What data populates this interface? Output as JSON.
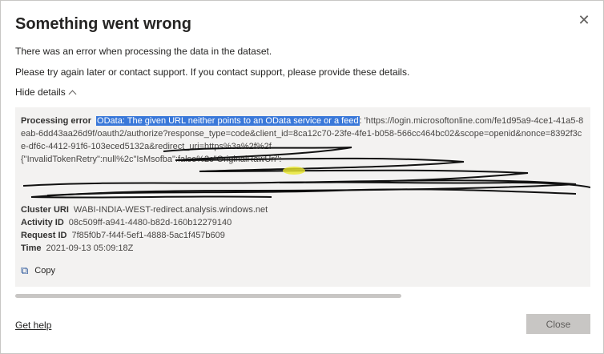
{
  "dialog": {
    "title": "Something went wrong",
    "message1": "There was an error when processing the data in the dataset.",
    "message2": "Please try again later or contact support. If you contact support, please provide these details.",
    "toggle_label": "Hide details"
  },
  "details": {
    "processing_error_label": "Processing error",
    "processing_error_highlight": "OData: The given URL neither points to an OData service or a feed",
    "processing_error_rest": ": 'https://login.microsoftonline.com/fe1d95a9-4ce1-41a5-8eab-6dd43aa26d9f/oauth2/authorize?response_type=code&client_id=8ca12c70-23fe-4fe1-b058-566cc464bc02&scope=openid&nonce=8392f3ce-df6c-4412-91f6-103eced5132a&redirect_uri=https%3a%2f%2f",
    "processing_error_line4": "{\"InvalidTokenRetry\":null%2c\"IsMsofba\":false%2c\"OriginalRawUri\":",
    "cluster_uri_label": "Cluster URI",
    "cluster_uri_value": "WABI-INDIA-WEST-redirect.analysis.windows.net",
    "activity_id_label": "Activity ID",
    "activity_id_value": "08c509ff-a941-4480-b82d-160b12279140",
    "request_id_label": "Request ID",
    "request_id_value": "7f85f0b7-f44f-5ef1-4888-5ac1f457b609",
    "time_label": "Time",
    "time_value": "2021-09-13 05:09:18Z",
    "copy_label": "Copy"
  },
  "footer": {
    "help_label": "Get help",
    "close_label": "Close"
  },
  "colors": {
    "highlight": "#3a78d9",
    "panel": "#f3f2f1",
    "disabled_button": "#c8c6c4"
  },
  "icons": {
    "close": "close-icon",
    "chevron": "chevron-up-icon",
    "copy": "copy-icon"
  }
}
